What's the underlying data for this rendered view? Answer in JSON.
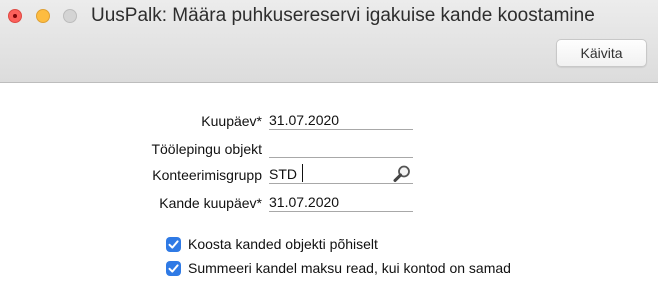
{
  "window": {
    "title": "UusPalk: Määra puhkusereservi igakuise kande koostamine",
    "run_button": "Käivita"
  },
  "form": {
    "date_label": "Kuupäev*",
    "date_value": "31.07.2020",
    "contract_label": "Töölepingu objekt",
    "contract_value": "",
    "account_group_label": "Konteerimisgrupp",
    "account_group_value": "STD",
    "entry_date_label": "Kande kuupäev*",
    "entry_date_value": "31.07.2020"
  },
  "options": {
    "by_object_label": "Koosta kanded objekti põhiselt",
    "by_object_checked": true,
    "summarize_label": "Summeeri kandel maksu read, kui kontod on samad",
    "summarize_checked": true
  },
  "colors": {
    "accent": "#2f7ae5",
    "close": "#fc605b",
    "minimize": "#fdbc40",
    "zoom": "#d4d4d4"
  },
  "icons": {
    "lookup": "magnifier-icon",
    "check": "checkmark-icon"
  }
}
